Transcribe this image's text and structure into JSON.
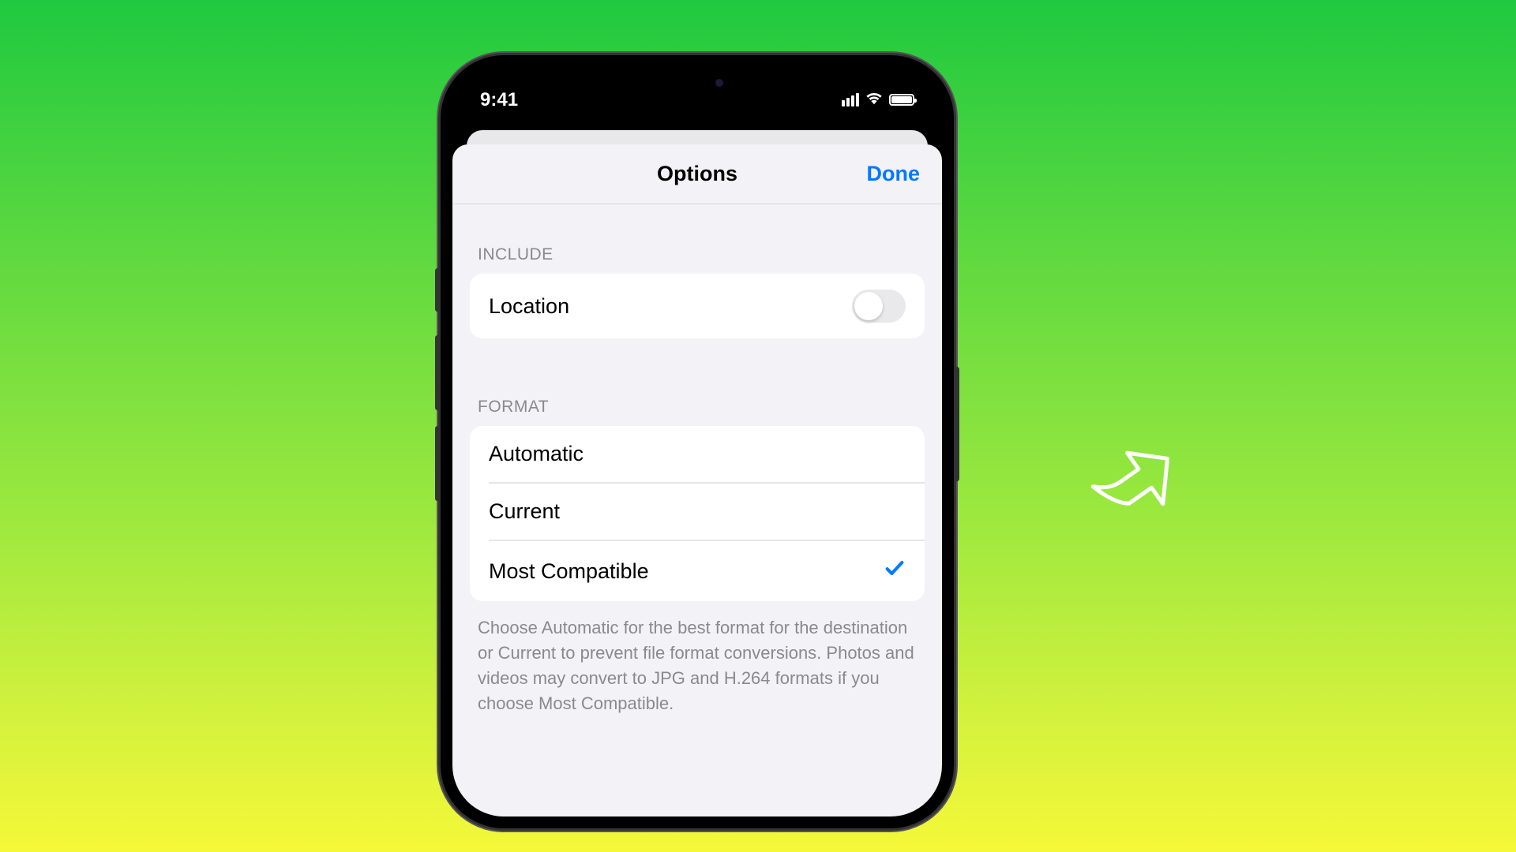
{
  "statusBar": {
    "time": "9:41"
  },
  "sheet": {
    "title": "Options",
    "doneLabel": "Done"
  },
  "sections": {
    "include": {
      "header": "INCLUDE",
      "location": {
        "label": "Location",
        "enabled": false
      }
    },
    "format": {
      "header": "FORMAT",
      "options": {
        "automatic": "Automatic",
        "current": "Current",
        "mostCompatible": "Most Compatible"
      },
      "selected": "mostCompatible",
      "footer": "Choose Automatic for the best format for the destination or Current to prevent file format conversions. Photos and videos may convert to JPG and H.264 formats if you choose Most Compatible."
    }
  }
}
